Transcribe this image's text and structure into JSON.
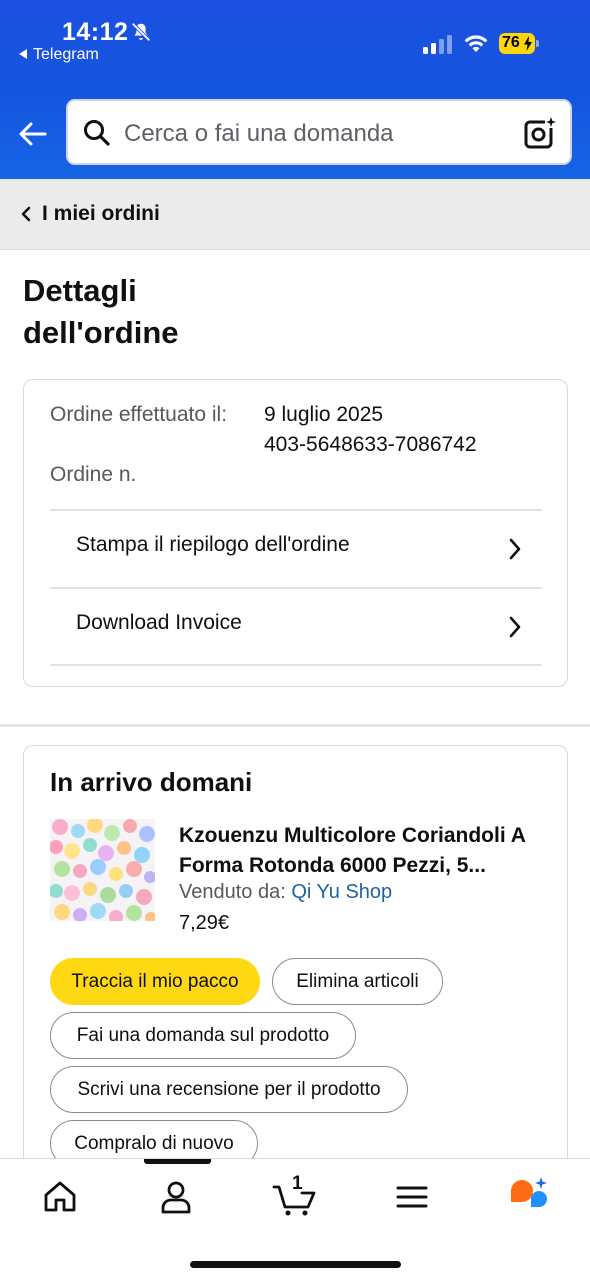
{
  "status_bar": {
    "time": "14:12",
    "back_app": "Telegram",
    "battery": "76"
  },
  "header": {
    "search": {
      "placeholder": "Cerca o fai una domanda"
    },
    "icons": [
      "back-arrow-icon",
      "search-icon",
      "camera-lens-icon"
    ]
  },
  "breadcrumb": {
    "label": "I miei ordini"
  },
  "page": {
    "title": "Dettagli dell'ordine"
  },
  "order": {
    "date_label": "Ordine effettuato il:",
    "date_value": "9 luglio 2025",
    "number_label": "Ordine n.",
    "number_value": "403-5648633-7086742",
    "links": [
      {
        "label": "Stampa il riepilogo dell'ordine"
      },
      {
        "label": "Download Invoice"
      }
    ]
  },
  "shipment": {
    "status": "In arrivo domani",
    "product": {
      "name": "Kzouenzu Multicolore Coriandoli A Forma Rotonda 6000 Pezzi, 5...",
      "sold_by_label": "Venduto da:",
      "seller": "Qi Yu Shop",
      "price": "7,29€"
    },
    "actions": {
      "track": "Traccia il mio pacco",
      "delete": "Elimina articoli",
      "ask": "Fai una domanda sul prodotto",
      "review": "Scrivi una recensione per il prodotto",
      "buy_again": "Compralo di nuovo"
    }
  },
  "bottom_nav": {
    "cart_count": "1",
    "items": [
      "home-icon",
      "account-icon",
      "cart-icon",
      "menu-icon",
      "rufus-ai-icon"
    ]
  },
  "colors": {
    "header_blue": "#1556df",
    "primary_button": "#ffd814",
    "link_blue": "#2162a1",
    "battery_yellow": "#ffd60a"
  }
}
